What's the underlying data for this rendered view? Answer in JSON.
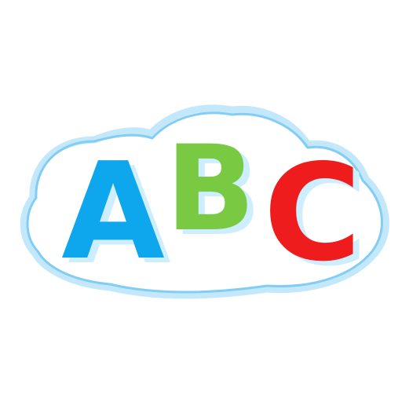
{
  "logo": {
    "letters": {
      "a": "A",
      "b": "B",
      "c": "C"
    },
    "colors": {
      "cloud_outline_outer": "#bfe6fb",
      "cloud_outline_inner": "#7cc8f2",
      "letter_a": "#0ea6ec",
      "letter_b": "#7ac943",
      "letter_c": "#ee1c1c",
      "shadow": "#cdeeff"
    },
    "icon": "abc-cloud-logo-icon"
  }
}
